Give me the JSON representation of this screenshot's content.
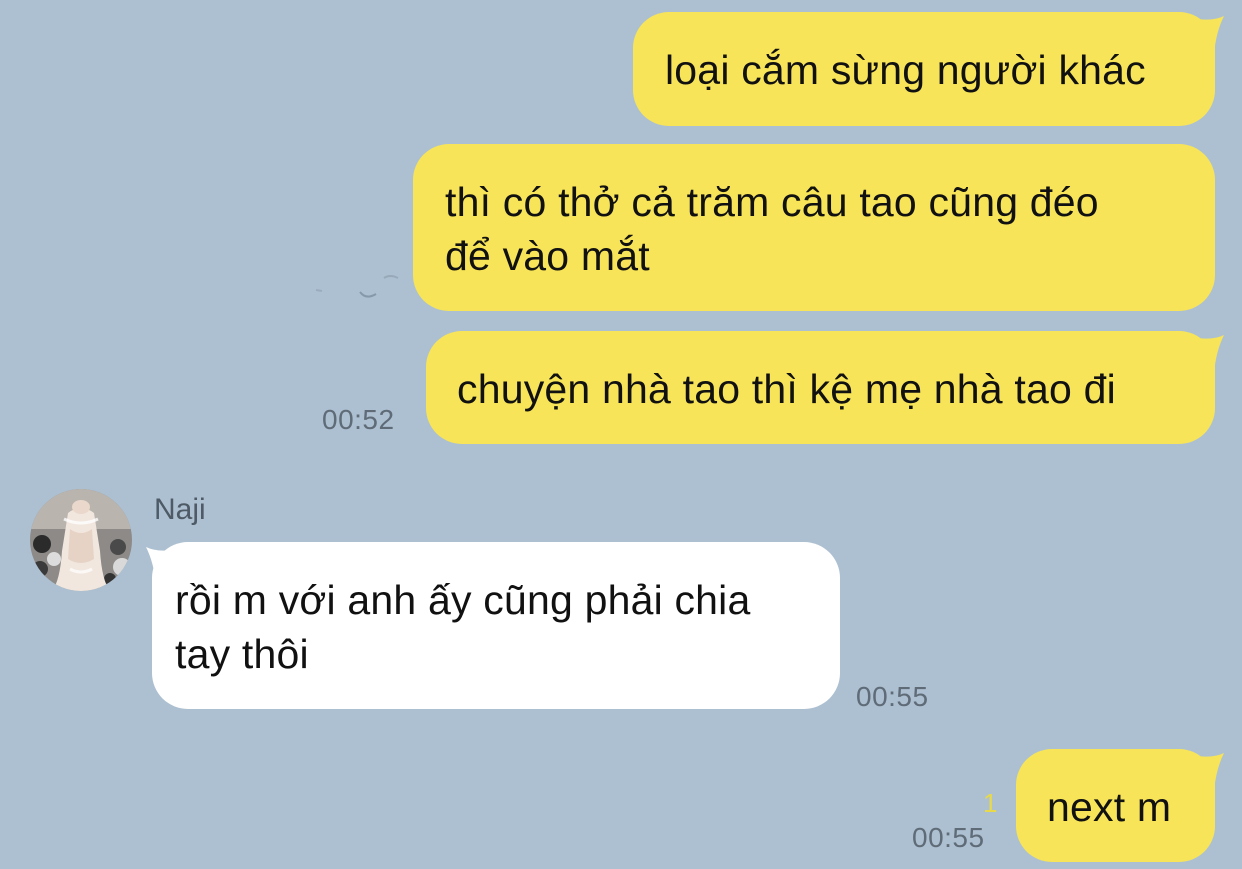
{
  "chat": {
    "contact_name": "Naji",
    "messages": [
      {
        "direction": "out",
        "lines": [
          "loại cắm sừng người khác"
        ]
      },
      {
        "direction": "out",
        "lines": [
          "thì có thở cả trăm câu tao cũng đéo",
          "để vào mắt"
        ]
      },
      {
        "direction": "out",
        "lines": [
          "chuyện nhà tao thì kệ mẹ nhà tao đi"
        ],
        "time": "00:52"
      },
      {
        "direction": "in",
        "sender": "Naji",
        "lines": [
          "rồi m với anh ấy cũng phải chia",
          "tay thôi"
        ],
        "time": "00:55"
      },
      {
        "direction": "out",
        "lines": [
          "next m"
        ],
        "time": "00:55",
        "read_count": "1"
      }
    ]
  },
  "colors": {
    "background": "#adc0d1",
    "outgoing_bubble": "#f7e458",
    "incoming_bubble": "#ffffff",
    "time_text": "#5f6b77",
    "read_count": "#e8d94a"
  },
  "icons": {
    "avatar": "contact-avatar-photo"
  }
}
